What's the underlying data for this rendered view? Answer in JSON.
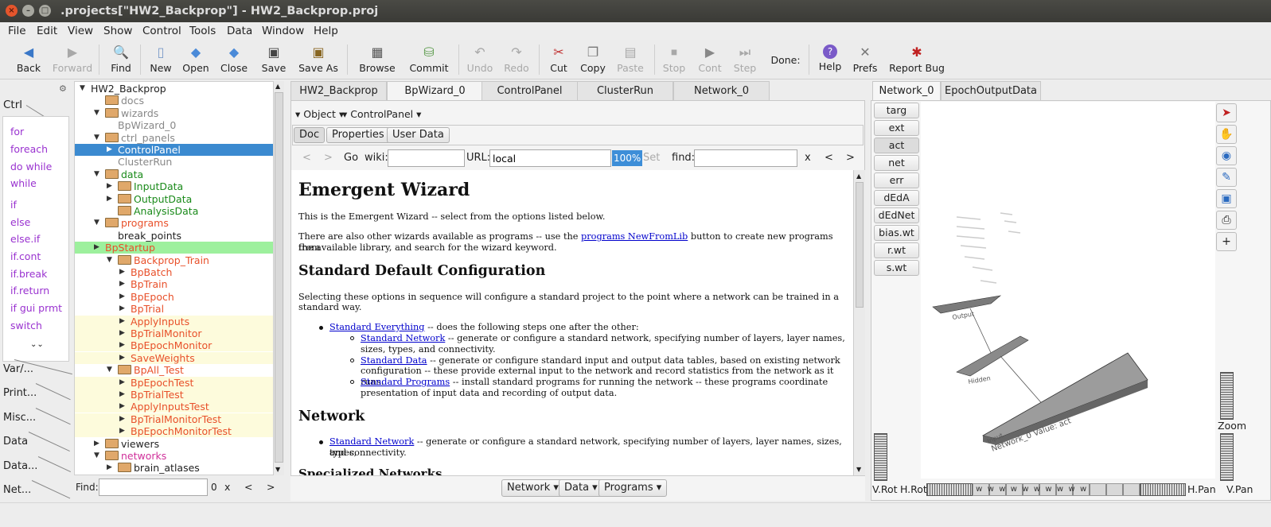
{
  "window": {
    "title": ".projects[\"HW2_Backprop\"] - HW2_Backprop.proj"
  },
  "menu": [
    "File",
    "Edit",
    "View",
    "Show",
    "Control",
    "Tools",
    "Data",
    "Window",
    "Help"
  ],
  "toolbar": {
    "back": "Back",
    "forward": "Forward",
    "find": "Find",
    "new": "New",
    "open": "Open",
    "close": "Close",
    "save": "Save",
    "save_as": "Save As",
    "browse": "Browse",
    "commit": "Commit",
    "undo": "Undo",
    "redo": "Redo",
    "cut": "Cut",
    "copy": "Copy",
    "paste": "Paste",
    "stop": "Stop",
    "cont": "Cont",
    "step": "Step",
    "done": "Done:",
    "help": "Help",
    "prefs": "Prefs",
    "report_bug": "Report Bug"
  },
  "left_tabs": {
    "ctrl": "Ctrl",
    "var": "Var/...",
    "print": "Print...",
    "misc": "Misc...",
    "data": "Data",
    "data2": "Data...",
    "net": "Net...",
    "ctrl_items": [
      "for",
      "foreach",
      "do while",
      "while",
      "if",
      "else",
      "else.if",
      "if.cont",
      "if.break",
      "if.return",
      "if gui prmt",
      "switch"
    ]
  },
  "tree": [
    {
      "label": "HW2_Backprop",
      "depth": 0,
      "arrow": "open",
      "folder": false,
      "color": "#222"
    },
    {
      "label": "docs",
      "depth": 1,
      "arrow": "",
      "folder": true,
      "color": "#888"
    },
    {
      "label": "wizards",
      "depth": 1,
      "arrow": "open",
      "folder": true,
      "color": "#888"
    },
    {
      "label": "BpWizard_0",
      "depth": 2,
      "arrow": "",
      "folder": false,
      "color": "#888"
    },
    {
      "label": "ctrl_panels",
      "depth": 1,
      "arrow": "open",
      "folder": true,
      "color": "#888"
    },
    {
      "label": "ControlPanel",
      "depth": 2,
      "arrow": "closed",
      "folder": false,
      "color": "#fff",
      "sel": true
    },
    {
      "label": "ClusterRun",
      "depth": 2,
      "arrow": "",
      "folder": false,
      "color": "#888"
    },
    {
      "label": "data",
      "depth": 1,
      "arrow": "open",
      "folder": true,
      "color": "#1a8a1a"
    },
    {
      "label": "InputData",
      "depth": 2,
      "arrow": "closed",
      "folder": true,
      "color": "#1a8a1a"
    },
    {
      "label": "OutputData",
      "depth": 2,
      "arrow": "closed",
      "folder": true,
      "color": "#1a8a1a"
    },
    {
      "label": "AnalysisData",
      "depth": 2,
      "arrow": "",
      "folder": true,
      "color": "#1a8a1a"
    },
    {
      "label": "programs",
      "depth": 1,
      "arrow": "open",
      "folder": true,
      "color": "#e8502a"
    },
    {
      "label": "break_points",
      "depth": 2,
      "arrow": "",
      "folder": false,
      "color": "#222"
    },
    {
      "label": "BpStartup",
      "depth": 1,
      "arrow": "closed",
      "folder": false,
      "color": "#e8502a",
      "bg": "#9df09d"
    },
    {
      "label": "Backprop_Train",
      "depth": 2,
      "arrow": "open",
      "folder": true,
      "color": "#e8502a"
    },
    {
      "label": "BpBatch",
      "depth": 3,
      "arrow": "closed",
      "folder": false,
      "color": "#e8502a"
    },
    {
      "label": "BpTrain",
      "depth": 3,
      "arrow": "closed",
      "folder": false,
      "color": "#e8502a"
    },
    {
      "label": "BpEpoch",
      "depth": 3,
      "arrow": "closed",
      "folder": false,
      "color": "#e8502a"
    },
    {
      "label": "BpTrial",
      "depth": 3,
      "arrow": "closed",
      "folder": false,
      "color": "#e8502a"
    },
    {
      "label": "ApplyInputs",
      "depth": 3,
      "arrow": "closed",
      "folder": false,
      "color": "#e8502a",
      "bg": "#fdfbdc"
    },
    {
      "label": "BpTrialMonitor",
      "depth": 3,
      "arrow": "closed",
      "folder": false,
      "color": "#e8502a",
      "bg": "#fdfbdc"
    },
    {
      "label": "BpEpochMonitor",
      "depth": 3,
      "arrow": "closed",
      "folder": false,
      "color": "#e8502a",
      "bg": "#fdfbdc"
    },
    {
      "label": "SaveWeights",
      "depth": 3,
      "arrow": "closed",
      "folder": false,
      "color": "#e8502a",
      "bg": "#fdfbdc"
    },
    {
      "label": "BpAll_Test",
      "depth": 2,
      "arrow": "open",
      "folder": true,
      "color": "#e8502a"
    },
    {
      "label": "BpEpochTest",
      "depth": 3,
      "arrow": "closed",
      "folder": false,
      "color": "#e8502a",
      "bg": "#fdfbdc"
    },
    {
      "label": "BpTrialTest",
      "depth": 3,
      "arrow": "closed",
      "folder": false,
      "color": "#e8502a",
      "bg": "#fdfbdc"
    },
    {
      "label": "ApplyInputsTest",
      "depth": 3,
      "arrow": "closed",
      "folder": false,
      "color": "#e8502a",
      "bg": "#fdfbdc"
    },
    {
      "label": "BpTrialMonitorTest",
      "depth": 3,
      "arrow": "closed",
      "folder": false,
      "color": "#e8502a",
      "bg": "#fdfbdc"
    },
    {
      "label": "BpEpochMonitorTest",
      "depth": 3,
      "arrow": "closed",
      "folder": false,
      "color": "#e8502a",
      "bg": "#fdfbdc"
    },
    {
      "label": "viewers",
      "depth": 1,
      "arrow": "closed",
      "folder": true,
      "color": "#222"
    },
    {
      "label": "networks",
      "depth": 1,
      "arrow": "open",
      "folder": true,
      "color": "#d0309a"
    },
    {
      "label": "brain_atlases",
      "depth": 2,
      "arrow": "closed",
      "folder": true,
      "color": "#222"
    },
    {
      "label": "Network_0",
      "depth": 1,
      "arrow": "open",
      "folder": false,
      "color": "#d0309a"
    }
  ],
  "tree_find": {
    "label": "Find:",
    "count": "0",
    "clear": "x",
    "prev": "<",
    "next": ">"
  },
  "center_tabs": [
    "HW2_Backprop",
    "BpWizard_0",
    "ControlPanel",
    "ClusterRun",
    "Network_0"
  ],
  "center": {
    "object_menu": "Object",
    "controlpanel_menu": "ControlPanel",
    "subtabs": [
      "Doc",
      "Properties",
      "User Data"
    ],
    "nav": {
      "back": "<",
      "fwd": ">",
      "go": "Go",
      "wiki": "wiki:",
      "url_label": "URL:",
      "url_value": "local",
      "zoom": "100%",
      "set": "Set",
      "find": "find:",
      "clear": "x",
      "prev": "<",
      "next": ">"
    }
  },
  "doc": {
    "title": "Emergent Wizard",
    "intro": "This is the Emergent Wizard -- select from the options listed below.",
    "p2_pre": "There are also other wizards available as programs -- use the ",
    "p2_link": "programs NewFromLib",
    "p2_post": " button to create new programs from",
    "p2_line2": "the available library, and search for the wizard keyword.",
    "h2_std": "Standard Default Configuration",
    "std_desc1": "Selecting these options in sequence will configure a standard project to the point where a network can be trained in a",
    "std_desc2": "standard way.",
    "b1_link": "Standard Everything",
    "b1_text": " -- does the following steps one after the other:",
    "s1_link": "Standard Network",
    "s1_text": " -- generate or configure a standard network, specifying number of layers, layer names,",
    "s1_text2": "sizes, types, and connectivity.",
    "s2_link": "Standard Data",
    "s2_text": " -- generate or configure standard input and output data tables, based on existing network",
    "s2_text2": "configuration -- these provide external input to the network and record statistics from the network as it runs.",
    "s3_link": "Standard Programs",
    "s3_text": " -- install standard programs for running the network -- these programs coordinate",
    "s3_text2": "presentation of input data and recording of output data.",
    "h2_net": "Network",
    "n1_link": "Standard Network",
    "n1_text": " -- generate or configure a standard network, specifying number of layers, layer names, sizes, types,",
    "n1_text2": "and connectivity.",
    "h2_spec": "Specialized Networks"
  },
  "bottom_buttons": [
    "Network",
    "Data",
    "Programs"
  ],
  "right_tabs": [
    "Network_0",
    "EpochOutputData"
  ],
  "var_buttons": [
    "targ",
    "ext",
    "act",
    "net",
    "err",
    "dEdA",
    "dEdNet",
    "bias.wt",
    "r.wt",
    "s.wt"
  ],
  "net_view": {
    "layer_out": "Output",
    "layer_hidden": "Hidden",
    "layer_input": "Input",
    "net_label": "Network_0 Value: act"
  },
  "right_bottom": {
    "vrot": "V.Rot",
    "hrot": "H.Rot",
    "hpan": "H.Pan",
    "vpan": "V.Pan",
    "zoom": "Zoom"
  }
}
